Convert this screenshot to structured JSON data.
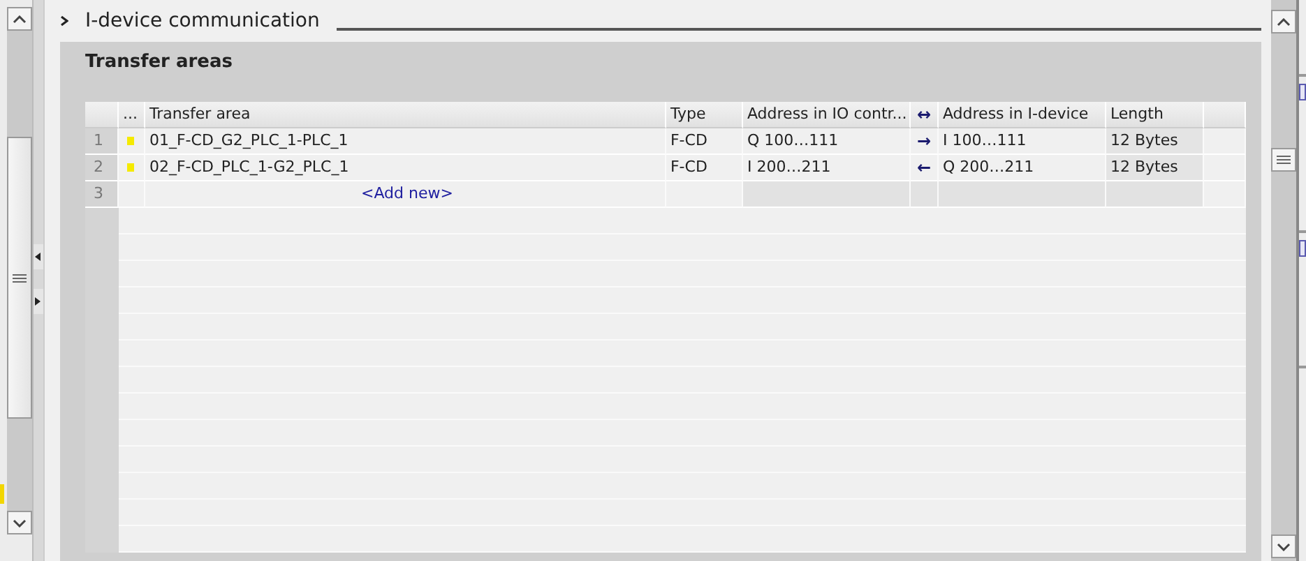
{
  "section": {
    "title": "I-device communication"
  },
  "panel": {
    "title": "Transfer areas"
  },
  "table": {
    "columns": [
      {
        "label": "..."
      },
      {
        "label": "Transfer area"
      },
      {
        "label": "Type"
      },
      {
        "label": "Address in IO contr..."
      },
      {
        "label": "↔"
      },
      {
        "label": "Address in I-device"
      },
      {
        "label": "Length"
      }
    ],
    "rows": [
      {
        "number": "1",
        "name": "01_F-CD_G2_PLC_1-PLC_1",
        "type": "F-CD",
        "address_io": "Q 100…111",
        "arrow": "→",
        "address_device": "I 100…111",
        "length": "12 Bytes"
      },
      {
        "number": "2",
        "name": "02_F-CD_PLC_1-G2_PLC_1",
        "type": "F-CD",
        "address_io": "I 200…211",
        "arrow": "←",
        "address_device": "Q 200…211",
        "length": "12 Bytes"
      }
    ],
    "add_row": {
      "number": "3",
      "label": "<Add new>"
    }
  }
}
